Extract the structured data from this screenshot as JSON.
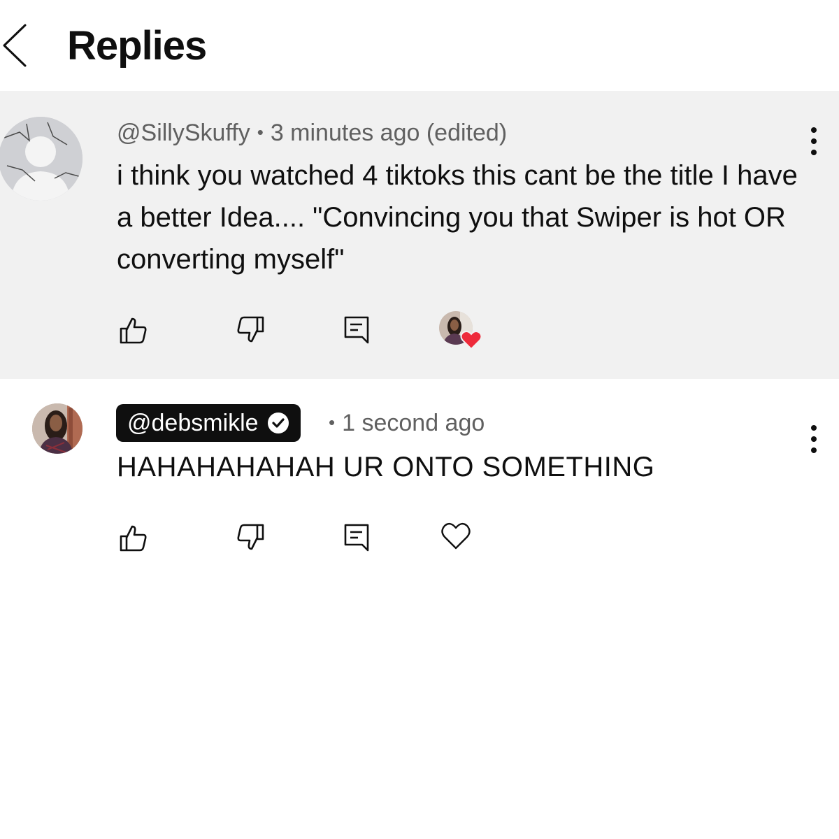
{
  "header": {
    "title": "Replies",
    "back_icon": "chevron-left-icon"
  },
  "parent_comment": {
    "author": "@SillySkuffy",
    "separator": "•",
    "time": "3 minutes ago (edited)",
    "text": "i think you watched 4 tiktoks this cant be the title I have a better Idea.... \"Convincing you that Swiper is hot OR converting myself\"",
    "creator_hearted": true
  },
  "reply_comment": {
    "author": "@debsmikle",
    "verified": true,
    "separator": "•",
    "time": "1 second ago",
    "text": "HAHAHAHAHAH UR ONTO SOMETHING"
  },
  "colors": {
    "heart_red": "#ee2a3a",
    "parent_bg": "#f1f1f1",
    "pill_bg": "#0f0f0f",
    "meta_gray": "#606060"
  }
}
